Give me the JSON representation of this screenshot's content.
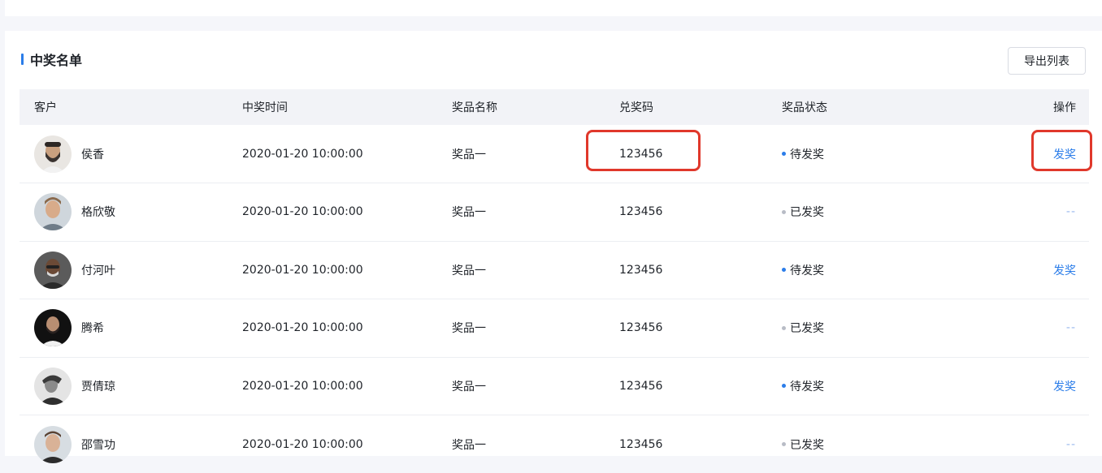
{
  "section": {
    "title": "中奖名单",
    "export_label": "导出列表"
  },
  "table": {
    "headers": [
      "客户",
      "中奖时间",
      "奖品名称",
      "兑奖码",
      "奖品状态",
      "操作"
    ],
    "rows": [
      {
        "customer": "侯香",
        "time": "2020-01-20 10:00:00",
        "prize": "奖品一",
        "code": "123456",
        "status": "待发奖",
        "action": "发奖"
      },
      {
        "customer": "格欣敬",
        "time": "2020-01-20 10:00:00",
        "prize": "奖品一",
        "code": "123456",
        "status": "已发奖",
        "action": "--"
      },
      {
        "customer": "付河叶",
        "time": "2020-01-20 10:00:00",
        "prize": "奖品一",
        "code": "123456",
        "status": "待发奖",
        "action": "发奖"
      },
      {
        "customer": "腾希",
        "time": "2020-01-20 10:00:00",
        "prize": "奖品一",
        "code": "123456",
        "status": "已发奖",
        "action": "--"
      },
      {
        "customer": "贾倩琼",
        "time": "2020-01-20 10:00:00",
        "prize": "奖品一",
        "code": "123456",
        "status": "待发奖",
        "action": "发奖"
      },
      {
        "customer": "邵雪功",
        "time": "2020-01-20 10:00:00",
        "prize": "奖品一",
        "code": "123456",
        "status": "已发奖",
        "action": "--"
      }
    ]
  },
  "colors": {
    "accent": "#2b7de9",
    "pending_dot": "#2b7de9",
    "done_dot": "#b8bcc6",
    "highlight": "#e0382b"
  }
}
